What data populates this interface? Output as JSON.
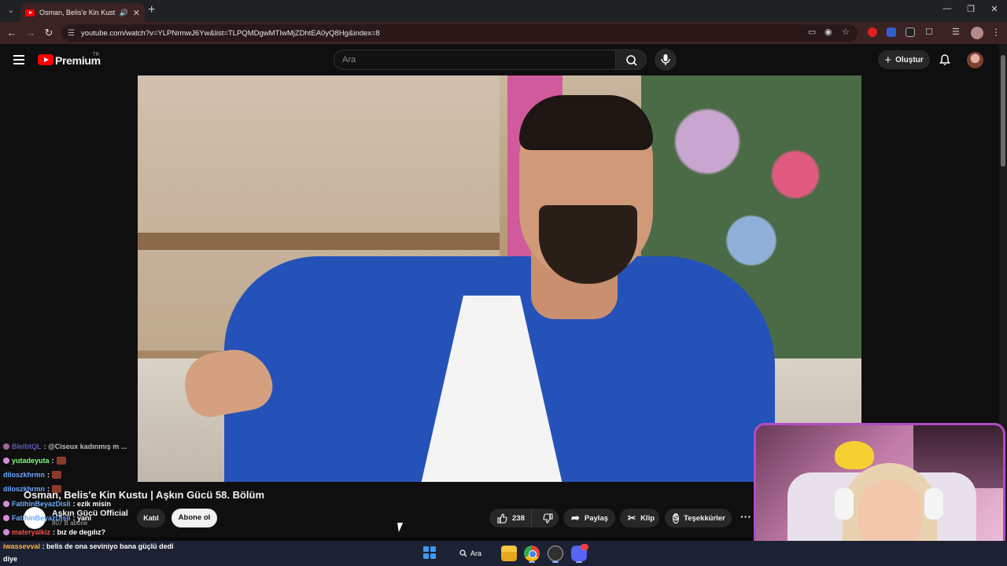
{
  "browser": {
    "tab_title": "Osman, Belis'e Kin Kustu | A",
    "url": "youtube.com/watch?v=YLPNrmwJ6Yw&list=TLPQMDgwMTIwMjZDhtEA0yQ8Hg&index=8",
    "new_tab_label": "+"
  },
  "youtube": {
    "brand": "Premium",
    "region": "TR",
    "search_placeholder": "Ara",
    "create_label": "Oluştur"
  },
  "video": {
    "title": "Osman, Belis'e Kin Kustu | Aşkın Gücü 58. Bölüm",
    "channel_name": "Aşkın Gücü Official",
    "subscribers": "807 B abone",
    "join_label": "Katıl",
    "subscribe_label": "Abone ol",
    "like_count": "238",
    "share_label": "Paylaş",
    "clip_label": "Klip",
    "thanks_label": "Teşekkürler",
    "more_label": "···"
  },
  "chat": {
    "lines": [
      {
        "user": "BlelbtQL",
        "msg": ": @Ciseux kadınmış m ...",
        "user_color": "#7a7aff"
      },
      {
        "user": "yutadeyuta",
        "msg": ":",
        "user_color": "#7cff7c"
      },
      {
        "user": "diloszkhrmn",
        "msg": ":",
        "user_color": "#6aa8ff"
      },
      {
        "user": "diloszkhrmn",
        "msg": ":",
        "user_color": "#6aa8ff"
      },
      {
        "user": "FatihinBeyazDisli",
        "msg": ": ezik misin",
        "user_color": "#6aa8ff"
      },
      {
        "user": "FatihinBeyazDisli",
        "msg": ": yani",
        "user_color": "#6aa8ff"
      },
      {
        "user": "materyalkiz",
        "msg": ": bız de degılız?",
        "user_color": "#ff4a4a"
      }
    ],
    "bottom_user": "iwassevval",
    "bottom_msg": ": belis de ona seviniyo bana güçlü dedi",
    "bottom_msg2": "diye"
  },
  "taskbar": {
    "search_label": "Ara"
  },
  "colors": {
    "youtube_red": "#ff0000",
    "webcam_border": "#b04cc5",
    "tab_bg": "#3b2323"
  }
}
